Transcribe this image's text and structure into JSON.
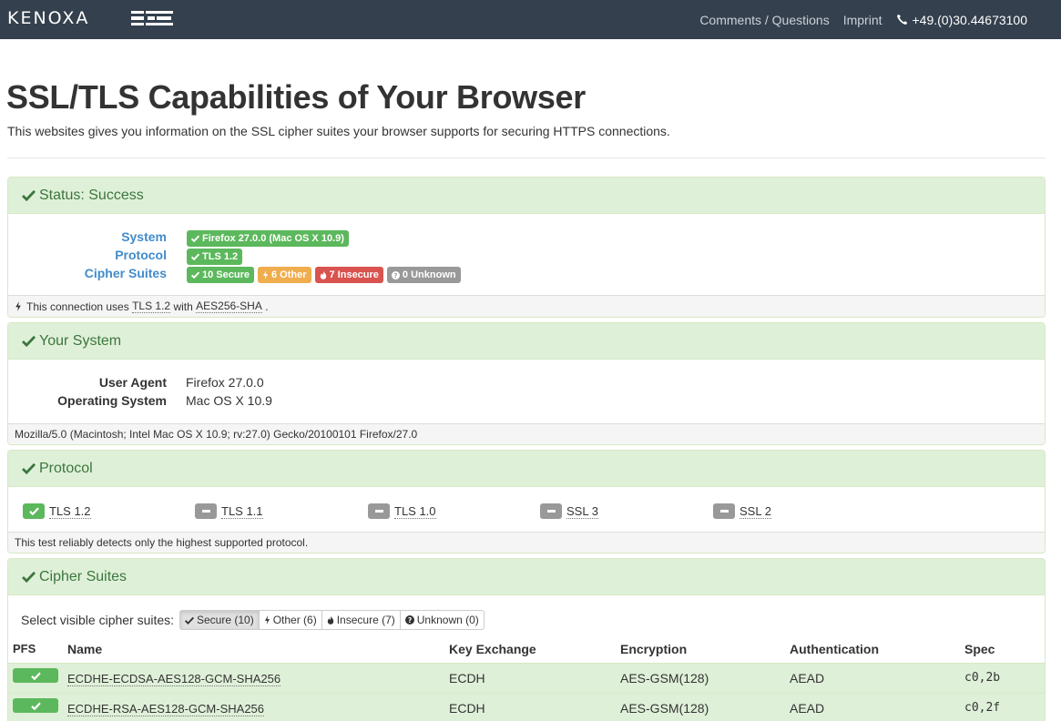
{
  "navbar": {
    "brand": "KENOXA",
    "links": [
      "Comments / Questions",
      "Imprint"
    ],
    "phone": "+49.(0)30.44673100"
  },
  "header": {
    "title": "SSL/TLS Capabilities of Your Browser",
    "lead": "This websites gives you information on the SSL cipher suites your browser supports for securing HTTPS connections."
  },
  "status": {
    "heading": "Status: Success",
    "labels": {
      "system": "System",
      "protocol": "Protocol",
      "cipher_suites": "Cipher Suites"
    },
    "system_badge": "Firefox 27.0.0 (Mac OS X 10.9)",
    "protocol_badge": "TLS 1.2",
    "cipher_badges": [
      "10 Secure",
      "6 Other",
      "7 Insecure",
      "0 Unknown"
    ],
    "footer_prefix": "This connection uses",
    "footer_protocol": "TLS 1.2",
    "footer_with": "with",
    "footer_cipher": "AES256-SHA",
    "footer_suffix": "."
  },
  "your_system": {
    "heading": "Your System",
    "user_agent_label": "User Agent",
    "user_agent_value": "Firefox 27.0.0",
    "os_label": "Operating System",
    "os_value": "Mac OS X 10.9",
    "footer": "Mozilla/5.0 (Macintosh; Intel Mac OS X 10.9; rv:27.0) Gecko/20100101 Firefox/27.0"
  },
  "protocol": {
    "heading": "Protocol",
    "items": [
      {
        "name": "TLS 1.2",
        "supported": true
      },
      {
        "name": "TLS 1.1",
        "supported": false
      },
      {
        "name": "TLS 1.0",
        "supported": false
      },
      {
        "name": "SSL 3",
        "supported": false
      },
      {
        "name": "SSL 2",
        "supported": false
      }
    ],
    "footer": "This test reliably detects only the highest supported protocol."
  },
  "cipher_suites": {
    "heading": "Cipher Suites",
    "filter_label": "Select visible cipher suites:",
    "filters": [
      "Secure (10)",
      "Other (6)",
      "Insecure (7)",
      "Unknown (0)"
    ],
    "columns": [
      "PFS",
      "Name",
      "Key Exchange",
      "Encryption",
      "Authentication",
      "Spec"
    ],
    "rows": [
      {
        "pfs": true,
        "name": "ECDHE-ECDSA-AES128-GCM-SHA256",
        "kx": "ECDH",
        "enc": "AES-GSM(128)",
        "auth": "AEAD",
        "spec": "c0,2b"
      },
      {
        "pfs": true,
        "name": "ECDHE-RSA-AES128-GCM-SHA256",
        "kx": "ECDH",
        "enc": "AES-GSM(128)",
        "auth": "AEAD",
        "spec": "c0,2f"
      }
    ]
  },
  "colors": {
    "navbar": "#34404d",
    "success": "#5cb85c",
    "warning": "#f0ad4e",
    "danger": "#d9534f",
    "default": "#999999",
    "panel_heading": "#dff0d8",
    "link": "#428bca"
  }
}
